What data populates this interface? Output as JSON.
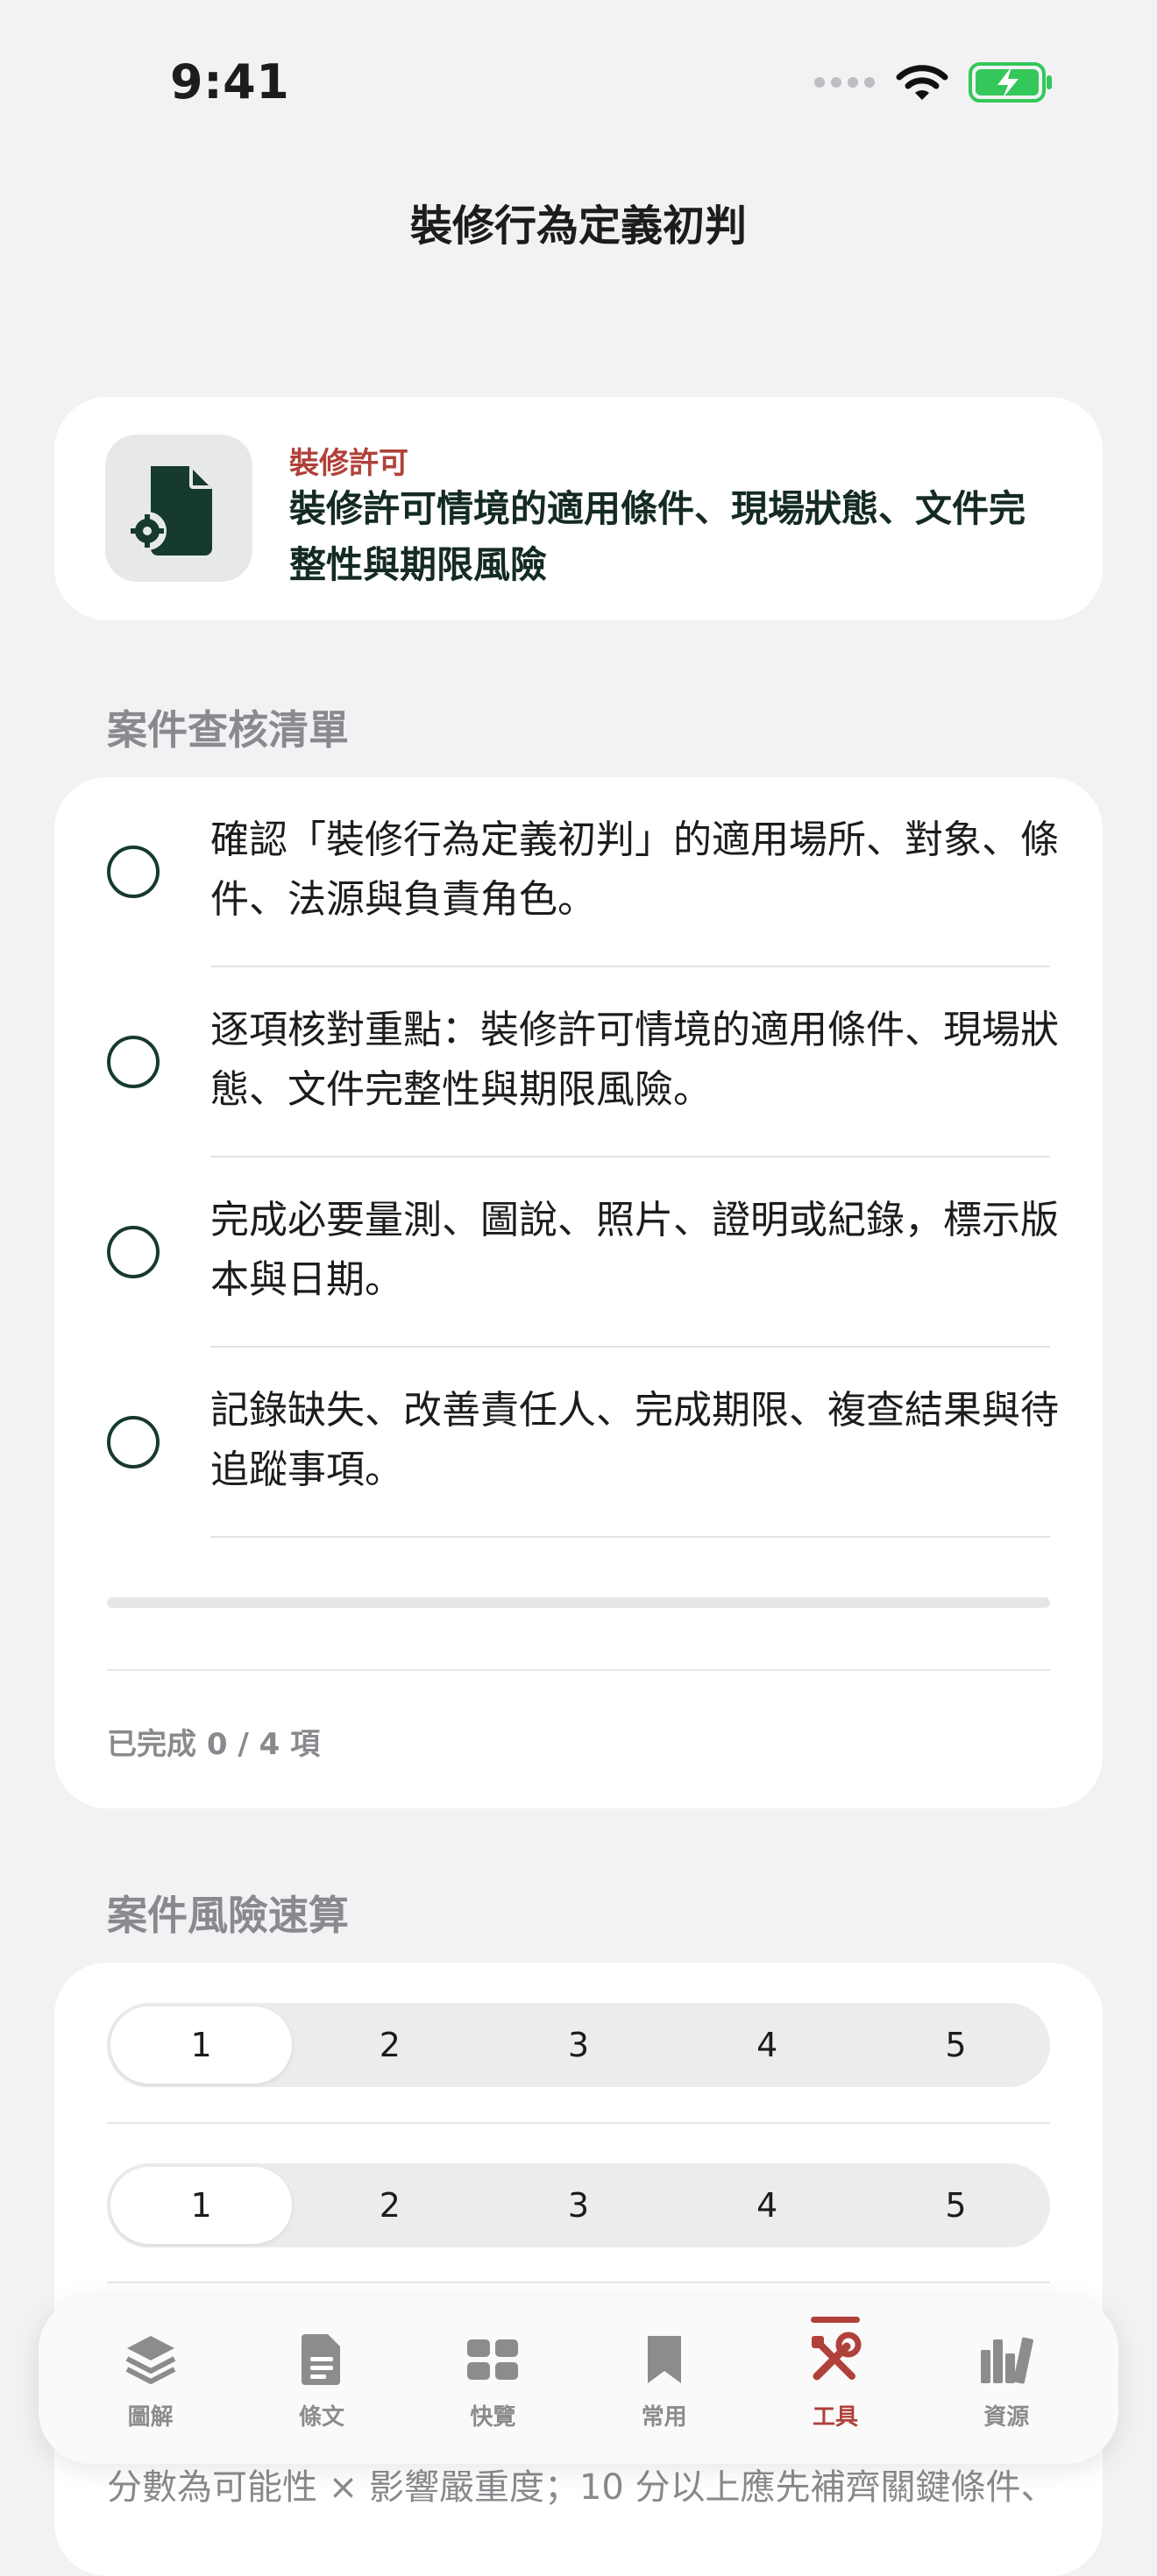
{
  "status": {
    "time": "9:41"
  },
  "nav": {
    "title": "裝修行為定義初判"
  },
  "header_card": {
    "kicker": "裝修許可",
    "title": "裝修許可情境的適用條件、現場狀態、文件完整性與期限風險"
  },
  "checklist": {
    "section_title": "案件查核清單",
    "items": [
      {
        "text": "確認「裝修行為定義初判」的適用場所、對象、條件、法源與負責角色。"
      },
      {
        "text": "逐項核對重點：裝修許可情境的適用條件、現場狀態、文件完整性與期限風險。"
      },
      {
        "text": "完成必要量測、圖說、照片、證明或紀錄，標示版本與日期。"
      },
      {
        "text": "記錄缺失、改善責任人、完成期限、複查結果與待追蹤事項。"
      }
    ],
    "progress": 0,
    "done_text": "已完成 0 / 4 項"
  },
  "risk": {
    "section_title": "案件風險速算",
    "likelihood_options": [
      "1",
      "2",
      "3",
      "4",
      "5"
    ],
    "likelihood_selected": "1",
    "severity_options": [
      "1",
      "2",
      "3",
      "4",
      "5"
    ],
    "severity_selected": "1",
    "note": "分數為可能性 × 影響嚴重度；10 分以上應先補齊關鍵條件、"
  },
  "tabbar": {
    "tabs": [
      {
        "label": "圖解",
        "icon": "layers-icon"
      },
      {
        "label": "條文",
        "icon": "document-icon"
      },
      {
        "label": "快覽",
        "icon": "grid-icon"
      },
      {
        "label": "常用",
        "icon": "bookmark-icon"
      },
      {
        "label": "工具",
        "icon": "tools-icon",
        "active": true
      },
      {
        "label": "資源",
        "icon": "library-icon"
      }
    ]
  },
  "colors": {
    "accent": "#B0413A",
    "brand_dark": "#163A2D",
    "background": "#F2F2F4"
  }
}
